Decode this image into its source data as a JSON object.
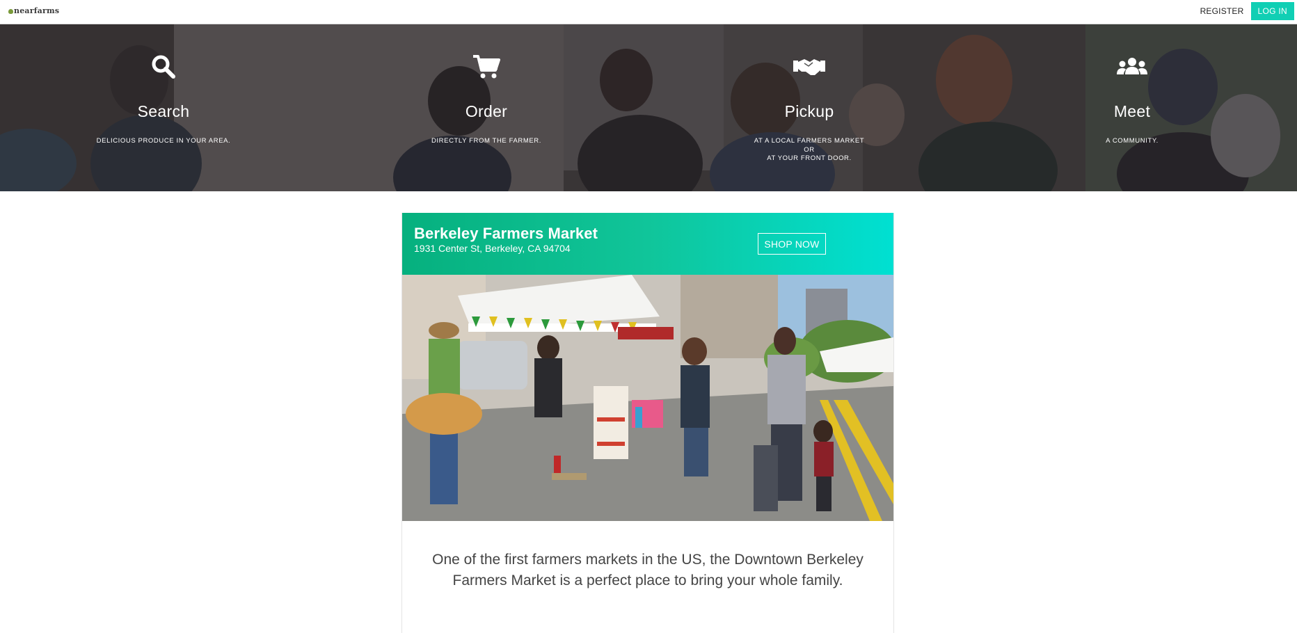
{
  "nav": {
    "logo_text": "nearfarms",
    "register_label": "REGISTER",
    "login_label": "LOG IN"
  },
  "hero": {
    "features": [
      {
        "icon": "search-icon",
        "title": "Search",
        "description": "DELICIOUS PRODUCE IN YOUR AREA."
      },
      {
        "icon": "shopping-cart-icon",
        "title": "Order",
        "description": "DIRECTLY FROM THE FARMER."
      },
      {
        "icon": "handshake-icon",
        "title": "Pickup",
        "description": "AT A LOCAL FARMERS MARKET\nOR\nAT YOUR FRONT DOOR."
      },
      {
        "icon": "users-icon",
        "title": "Meet",
        "description": "A COMMUNITY."
      }
    ]
  },
  "market": {
    "name": "Berkeley Farmers Market",
    "address": "1931 Center St, Berkeley, CA 94704",
    "shop_label": "SHOP NOW",
    "description": "One of the first farmers markets in the US, the Downtown Berkeley Farmers Market is a perfect place to bring your whole family."
  },
  "colors": {
    "accent": "#10cfb4",
    "header_gradient_start": "#06b07e",
    "header_gradient_end": "#00e0d2"
  }
}
